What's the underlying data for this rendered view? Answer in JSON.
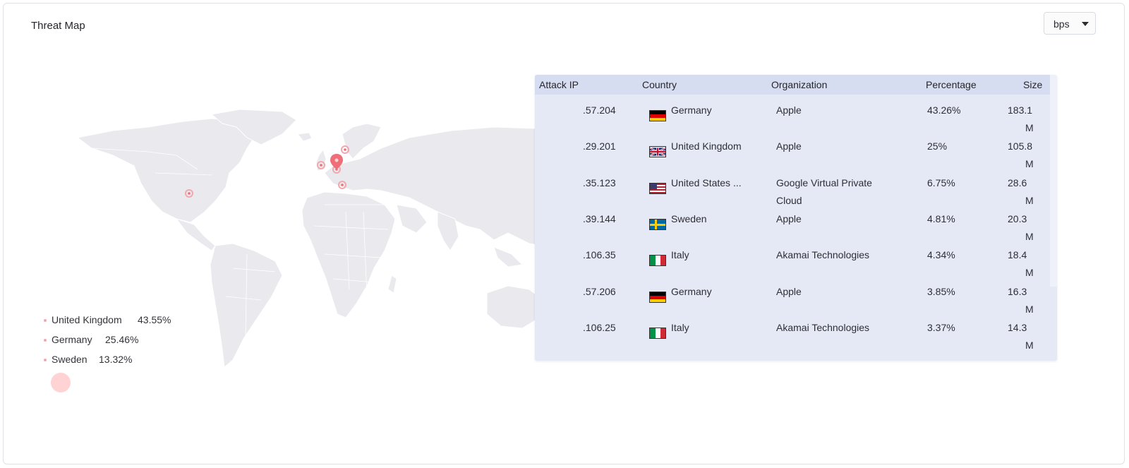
{
  "widget": {
    "title": "Threat Map",
    "unit_select": {
      "value": "bps"
    }
  },
  "legend": [
    {
      "country": "United Kingdom",
      "percentage": "43.55%"
    },
    {
      "country": "Germany",
      "percentage": "25.46%"
    },
    {
      "country": "Sweden",
      "percentage": "13.32%"
    }
  ],
  "table": {
    "headers": {
      "attack_ip": "Attack IP",
      "country": "Country",
      "organization": "Organization",
      "percentage": "Percentage",
      "size": "Size"
    },
    "rows": [
      {
        "ip": ".57.204",
        "flag": "germany-flag-icon",
        "country": "Germany",
        "org": "Apple",
        "org2": "",
        "pct": "43.26%",
        "size": "183.1",
        "size_unit": "M"
      },
      {
        "ip": ".29.201",
        "flag": "uk-flag-icon",
        "country": "United Kingdom",
        "org": "Apple",
        "org2": "",
        "pct": "25%",
        "size": "105.8",
        "size_unit": "M"
      },
      {
        "ip": ".35.123",
        "flag": "us-flag-icon",
        "country": "United States ...",
        "org": "Google Virtual Private",
        "org2": "Cloud",
        "pct": "6.75%",
        "size": "28.6",
        "size_unit": "M"
      },
      {
        "ip": ".39.144",
        "flag": "sweden-flag-icon",
        "country": "Sweden",
        "org": "Apple",
        "org2": "",
        "pct": "4.81%",
        "size": "20.3",
        "size_unit": "M"
      },
      {
        "ip": ".106.35",
        "flag": "italy-flag-icon",
        "country": "Italy",
        "org": "Akamai Technologies",
        "org2": "",
        "pct": "4.34%",
        "size": "18.4",
        "size_unit": "M"
      },
      {
        "ip": ".57.206",
        "flag": "germany-flag-icon",
        "country": "Germany",
        "org": "Apple",
        "org2": "",
        "pct": "3.85%",
        "size": "16.3",
        "size_unit": "M"
      },
      {
        "ip": ".106.25",
        "flag": "italy-flag-icon",
        "country": "Italy",
        "org": "Akamai Technologies",
        "org2": "",
        "pct": "3.37%",
        "size": "14.3",
        "size_unit": "M"
      }
    ]
  },
  "colors": {
    "land": "#e9e9ee",
    "marker": "#ef6f78",
    "table_bg": "#e5e9f6",
    "header_bg": "#d6ddf0"
  }
}
